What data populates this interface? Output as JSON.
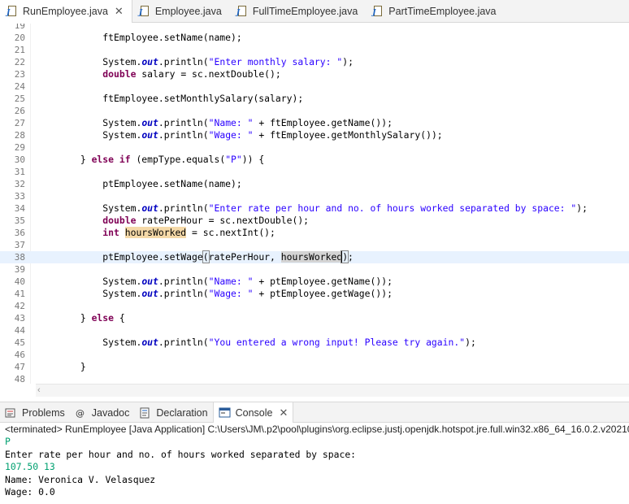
{
  "editor_tabs": [
    {
      "label": "RunEmployee.java",
      "active": true,
      "closable": true
    },
    {
      "label": "Employee.java",
      "active": false,
      "closable": false
    },
    {
      "label": "FullTimeEmployee.java",
      "active": false,
      "closable": false
    },
    {
      "label": "PartTimeEmployee.java",
      "active": false,
      "closable": false
    }
  ],
  "close_glyph": "✕",
  "code": {
    "current_line": "38",
    "lines": [
      {
        "n": "19",
        "segs": []
      },
      {
        "n": "20",
        "segs": [
          {
            "t": "            ftEmployee.setName(name);"
          }
        ]
      },
      {
        "n": "21",
        "segs": []
      },
      {
        "n": "22",
        "segs": [
          {
            "t": "            System."
          },
          {
            "t": "out",
            "c": "fld"
          },
          {
            "t": ".println("
          },
          {
            "t": "\"Enter monthly salary: \"",
            "c": "str"
          },
          {
            "t": ");"
          }
        ]
      },
      {
        "n": "23",
        "segs": [
          {
            "t": "            "
          },
          {
            "t": "double",
            "c": "kw"
          },
          {
            "t": " salary = sc.nextDouble();"
          }
        ]
      },
      {
        "n": "24",
        "segs": []
      },
      {
        "n": "25",
        "segs": [
          {
            "t": "            ftEmployee.setMonthlySalary(salary);"
          }
        ]
      },
      {
        "n": "26",
        "segs": []
      },
      {
        "n": "27",
        "segs": [
          {
            "t": "            System."
          },
          {
            "t": "out",
            "c": "fld"
          },
          {
            "t": ".println("
          },
          {
            "t": "\"Name: \"",
            "c": "str"
          },
          {
            "t": " + ftEmployee.getName());"
          }
        ]
      },
      {
        "n": "28",
        "segs": [
          {
            "t": "            System."
          },
          {
            "t": "out",
            "c": "fld"
          },
          {
            "t": ".println("
          },
          {
            "t": "\"Wage: \"",
            "c": "str"
          },
          {
            "t": " + ftEmployee.getMonthlySalary());"
          }
        ]
      },
      {
        "n": "29",
        "segs": []
      },
      {
        "n": "30",
        "segs": [
          {
            "t": "        } "
          },
          {
            "t": "else",
            "c": "kw"
          },
          {
            "t": " "
          },
          {
            "t": "if",
            "c": "kw"
          },
          {
            "t": " (empType.equals("
          },
          {
            "t": "\"P\"",
            "c": "str"
          },
          {
            "t": ")) {"
          }
        ]
      },
      {
        "n": "31",
        "segs": []
      },
      {
        "n": "32",
        "segs": [
          {
            "t": "            ptEmployee.setName(name);"
          }
        ]
      },
      {
        "n": "33",
        "segs": []
      },
      {
        "n": "34",
        "segs": [
          {
            "t": "            System."
          },
          {
            "t": "out",
            "c": "fld"
          },
          {
            "t": ".println("
          },
          {
            "t": "\"Enter rate per hour and no. of hours worked separated by space: \"",
            "c": "str"
          },
          {
            "t": ");"
          }
        ]
      },
      {
        "n": "35",
        "segs": [
          {
            "t": "            "
          },
          {
            "t": "double",
            "c": "kw"
          },
          {
            "t": " ratePerHour = sc.nextDouble();"
          }
        ]
      },
      {
        "n": "36",
        "segs": [
          {
            "t": "            "
          },
          {
            "t": "int",
            "c": "kw"
          },
          {
            "t": " "
          },
          {
            "t": "hoursWorked",
            "c": "occ1"
          },
          {
            "t": " = sc.nextInt();"
          }
        ]
      },
      {
        "n": "37",
        "segs": []
      },
      {
        "n": "38",
        "segs": [
          {
            "t": "            ptEmployee.setWage"
          },
          {
            "t": "(",
            "c": "brk"
          },
          {
            "t": "ratePerHour, "
          },
          {
            "t": "hoursWorked",
            "c": "occ2"
          },
          {
            "t": ")",
            "c": "brk caret"
          },
          {
            "t": ";"
          }
        ]
      },
      {
        "n": "39",
        "segs": []
      },
      {
        "n": "40",
        "segs": [
          {
            "t": "            System."
          },
          {
            "t": "out",
            "c": "fld"
          },
          {
            "t": ".println("
          },
          {
            "t": "\"Name: \"",
            "c": "str"
          },
          {
            "t": " + ptEmployee.getName());"
          }
        ]
      },
      {
        "n": "41",
        "segs": [
          {
            "t": "            System."
          },
          {
            "t": "out",
            "c": "fld"
          },
          {
            "t": ".println("
          },
          {
            "t": "\"Wage: \"",
            "c": "str"
          },
          {
            "t": " + ptEmployee.getWage());"
          }
        ]
      },
      {
        "n": "42",
        "segs": []
      },
      {
        "n": "43",
        "segs": [
          {
            "t": "        } "
          },
          {
            "t": "else",
            "c": "kw"
          },
          {
            "t": " {"
          }
        ]
      },
      {
        "n": "44",
        "segs": []
      },
      {
        "n": "45",
        "segs": [
          {
            "t": "            System."
          },
          {
            "t": "out",
            "c": "fld"
          },
          {
            "t": ".println("
          },
          {
            "t": "\"You entered a wrong input! Please try again.\"",
            "c": "str"
          },
          {
            "t": ");"
          }
        ]
      },
      {
        "n": "46",
        "segs": []
      },
      {
        "n": "47",
        "segs": [
          {
            "t": "        }"
          }
        ]
      },
      {
        "n": "48",
        "segs": []
      }
    ]
  },
  "view_tabs": [
    {
      "label": "Problems",
      "icon": "problems-icon",
      "active": false
    },
    {
      "label": "Javadoc",
      "icon": "javadoc-icon",
      "active": false
    },
    {
      "label": "Declaration",
      "icon": "declaration-icon",
      "active": false
    },
    {
      "label": "Console",
      "icon": "console-icon",
      "active": true
    }
  ],
  "console": {
    "header": "<terminated> RunEmployee [Java Application] C:\\Users\\JM\\.p2\\pool\\plugins\\org.eclipse.justj.openjdk.hotspot.jre.full.win32.x86_64_16.0.2.v20210",
    "lines": [
      {
        "text": "P",
        "input": true
      },
      {
        "text": "Enter rate per hour and no. of hours worked separated by space:",
        "input": false
      },
      {
        "text": "107.50 13",
        "input": true
      },
      {
        "text": "Name: Veronica V. Velasquez",
        "input": false
      },
      {
        "text": "Wage: 0.0",
        "input": false
      }
    ]
  },
  "colors": {
    "keyword": "#7f0055",
    "string": "#2a00ff",
    "field": "#0000c0",
    "console_input": "#00a070",
    "current_line": "#e8f2fe"
  }
}
